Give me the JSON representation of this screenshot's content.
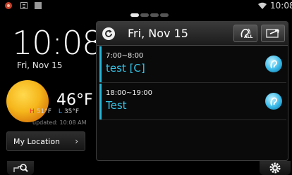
{
  "status_bar": {
    "time": "10:08",
    "icons": [
      "notification-icon",
      "document-icon",
      "sd-card-icon",
      "wifi-icon"
    ]
  },
  "page_indicator": {
    "count": 4,
    "active": 0
  },
  "clock": {
    "time": "10:08",
    "date": "Fri, Nov 15"
  },
  "weather": {
    "condition_icon": "sun-icon",
    "temp": "46°F",
    "high_tag": "H",
    "high": "51°F",
    "low_tag": "L",
    "low": "35°F",
    "updated": "updated: 10:08 AM"
  },
  "location": {
    "label": "My Location",
    "chevron": "›"
  },
  "calendar": {
    "date": "Fri, Nov 15",
    "all_label": "ALL",
    "events": [
      {
        "time": "7:00~8:00",
        "title": "test [C]"
      },
      {
        "time": "18:00~19:00",
        "title": "Test"
      }
    ]
  },
  "colors": {
    "accent": "#26b7d9",
    "high": "#e33333",
    "low": "#3aa0ff"
  }
}
